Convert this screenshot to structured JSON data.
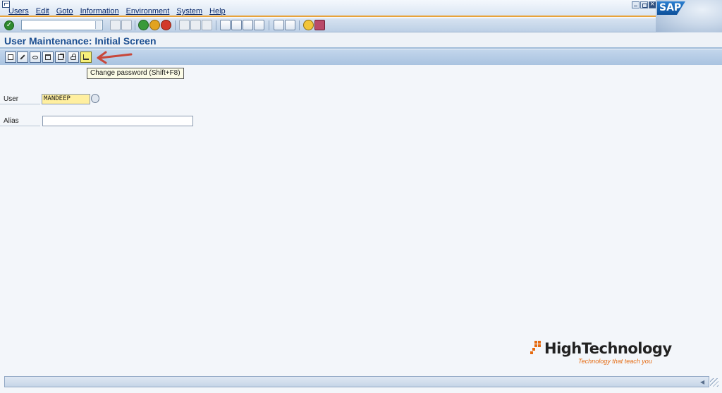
{
  "menu": [
    "Users",
    "Edit",
    "Goto",
    "Information",
    "Environment",
    "System",
    "Help"
  ],
  "sap_logo": "SAP",
  "command_field": {
    "value": ""
  },
  "title": "User Maintenance: Initial Screen",
  "tooltip": "Change password  (Shift+F8)",
  "form": {
    "user_label": "User",
    "user_value": "MANDEEP",
    "alias_label": "Alias",
    "alias_value": ""
  },
  "brand": {
    "name": "HighTechnology",
    "tagline": "Technology that teach you"
  },
  "colors": {
    "menu_border": "#e8a33b",
    "title": "#1d4f91",
    "highlight": "#f6f07a",
    "arrow": "#c8473a",
    "brand_accent": "#e56a10"
  }
}
